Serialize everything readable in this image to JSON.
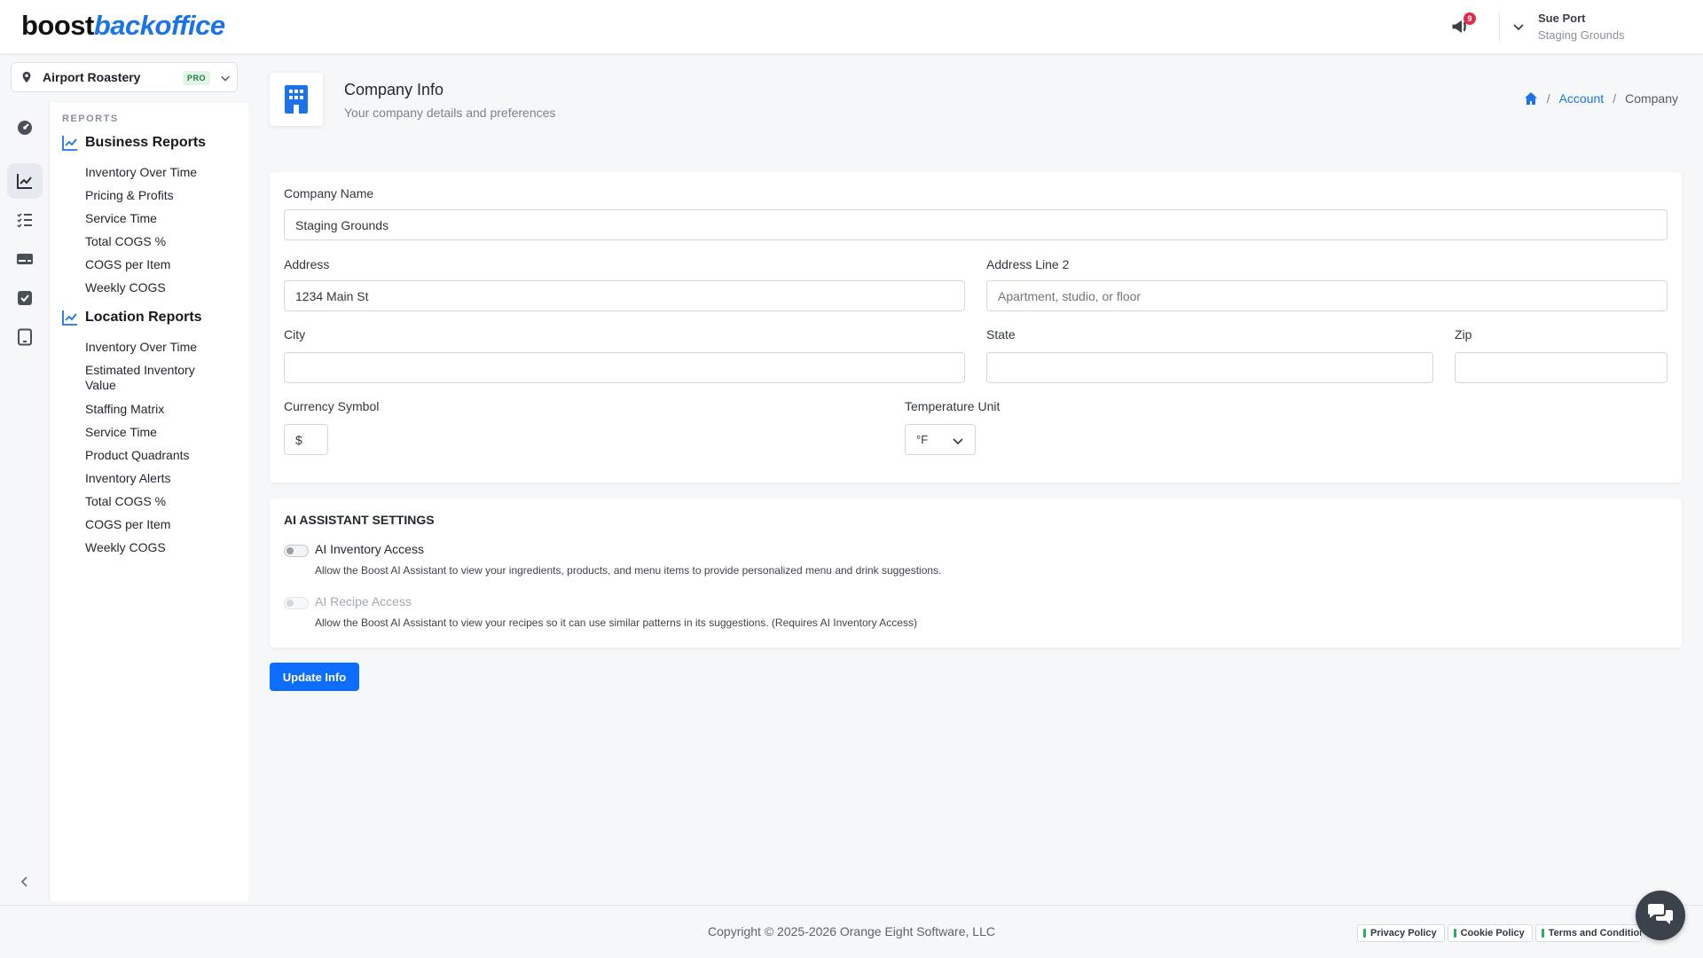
{
  "brand": {
    "part1": "boost",
    "part2": "backoffice"
  },
  "header": {
    "notification_count": "9",
    "user_name": "Sue Port",
    "user_org": "Staging Grounds"
  },
  "location": {
    "name": "Airport Roastery",
    "badge": "PRO"
  },
  "menu": {
    "caption": "REPORTS",
    "business": {
      "title": "Business Reports",
      "items": [
        "Inventory Over Time",
        "Pricing & Profits",
        "Service Time",
        "Total COGS %",
        "COGS per Item",
        "Weekly COGS"
      ]
    },
    "location": {
      "title": "Location Reports",
      "items": [
        "Inventory Over Time",
        "Estimated Inventory Value",
        "Staffing Matrix",
        "Service Time",
        "Product Quadrants",
        "Inventory Alerts",
        "Total COGS %",
        "COGS per Item",
        "Weekly COGS"
      ]
    }
  },
  "page": {
    "title": "Company Info",
    "subtitle": "Your company details and preferences",
    "breadcrumb": {
      "account": "Account",
      "separator": "/",
      "current": "Company"
    }
  },
  "form": {
    "company_name": {
      "label": "Company Name",
      "value": "Staging Grounds"
    },
    "address": {
      "label": "Address",
      "value": "1234 Main St"
    },
    "address2": {
      "label": "Address Line 2",
      "placeholder": "Apartment, studio, or floor"
    },
    "city": {
      "label": "City",
      "value": ""
    },
    "state": {
      "label": "State",
      "value": ""
    },
    "zip": {
      "label": "Zip",
      "value": ""
    },
    "currency": {
      "label": "Currency Symbol",
      "value": "$"
    },
    "temperature": {
      "label": "Temperature Unit",
      "value": "°F"
    }
  },
  "ai": {
    "title": "AI ASSISTANT SETTINGS",
    "inventory": {
      "label": "AI Inventory Access",
      "description": "Allow the Boost AI Assistant to view your ingredients, products, and menu items to provide personalized menu and drink suggestions."
    },
    "recipe": {
      "label": "AI Recipe Access",
      "description": "Allow the Boost AI Assistant to view your recipes so it can use similar patterns in its suggestions. (Requires AI Inventory Access)"
    }
  },
  "actions": {
    "update": "Update Info"
  },
  "footer": {
    "copyright": "Copyright © 2025-2026 Orange Eight Software, LLC",
    "privacy": "Privacy Policy",
    "cookie": "Cookie Policy",
    "terms": "Terms and Conditions"
  },
  "colors": {
    "accent": "#1a73e8",
    "primary_button": "#0d6efd",
    "badge": "#e02d4b"
  }
}
